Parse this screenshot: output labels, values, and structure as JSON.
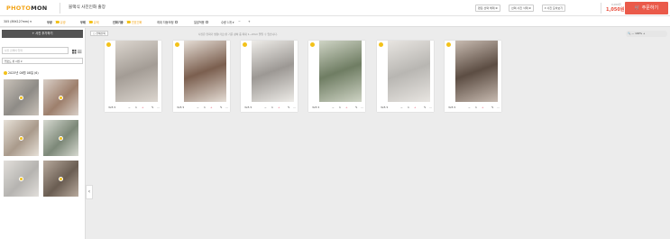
{
  "header": {
    "logo_a": "PHOTO",
    "logo_b": "MON",
    "brand_title": "블랙식 사진인화 출장",
    "buttons": [
      "편집 선택 해제 ⊗",
      "선택 사진 삭제 ⊗",
      "▾ 사진 모아보기"
    ],
    "price_label": "0,000원",
    "price": "1,050원",
    "order_label": "주문하기"
  },
  "toolbar": {
    "size_select": "3X5 (89X127mm) ▾",
    "option1_label": "무광",
    "option1_sub": "유광",
    "option2_label": "무테",
    "option2_sub": "유테",
    "option3_label": "인화기종",
    "option3_sub": "연흐인화",
    "option4_label": "최대 자동보정",
    "option5_label": "일괄적용",
    "qty": "수량 1개 ▾",
    "minus": "−",
    "plus": "+"
  },
  "sidebar": {
    "add_button": "+ 사진 추가하기",
    "search_placeholder": "사진 검색어 입력",
    "sort_select": "업로드 된 사진 ▾",
    "date_group": "2025년 08월 08일 (6)",
    "thumbs": [
      {
        "color1": "#8e8b86",
        "color2": "#c9c2b9"
      },
      {
        "color1": "#9d7f6c",
        "color2": "#d9cfc7"
      },
      {
        "color1": "#a99a8b",
        "color2": "#e7e1d8"
      },
      {
        "color1": "#7c8878",
        "color2": "#d6d9d0"
      },
      {
        "color1": "#b5b3b0",
        "color2": "#e2dfdb"
      },
      {
        "color1": "#6a5d52",
        "color2": "#b8aa9d"
      }
    ]
  },
  "main": {
    "select_all": "▢ 전체선택",
    "hint": "사진은 인화기 방향(가로)을 기준 상하 중 최대 1~2mm 잘릴 수 있습니다.",
    "zoom": "100%",
    "cards": [
      {
        "format": "3x5 ▾",
        "qty": "1",
        "color1": "#a39c95",
        "color2": "#dcd6cf"
      },
      {
        "format": "3x5 ▾",
        "qty": "1",
        "color1": "#7b5f4f",
        "color2": "#e5ddd5"
      },
      {
        "format": "3x5 ▾",
        "qty": "1",
        "color1": "#9c9894",
        "color2": "#eeece8"
      },
      {
        "format": "3x5 ▾",
        "qty": "1",
        "color1": "#6f7d63",
        "color2": "#cfd4c5"
      },
      {
        "format": "3x5 ▾",
        "qty": "1",
        "color1": "#b8b6b2",
        "color2": "#e8e5e1"
      },
      {
        "format": "3x5 ▾",
        "qty": "1",
        "color1": "#5c4d43",
        "color2": "#c8bbb1"
      }
    ]
  }
}
